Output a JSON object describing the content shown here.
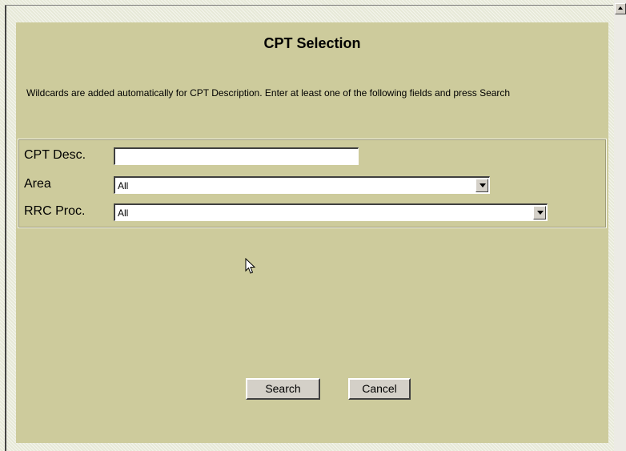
{
  "page": {
    "title": "CPT Selection",
    "instructions": "Wildcards are added automatically for CPT Description. Enter at least one of the following fields and press Search"
  },
  "form": {
    "cpt_desc": {
      "label": "CPT Desc.",
      "value": ""
    },
    "area": {
      "label": "Area",
      "value": "All"
    },
    "rrc_proc": {
      "label": "RRC Proc.",
      "value": "All"
    }
  },
  "buttons": {
    "search": "Search",
    "cancel": "Cancel"
  },
  "icons": {
    "cursor": "mouse-pointer-icon",
    "dropdown": "chevron-down-icon",
    "scroll_up": "scroll-up-arrow-icon"
  },
  "colors": {
    "panel": "#cdcb9c",
    "button": "#d4d0c8"
  }
}
